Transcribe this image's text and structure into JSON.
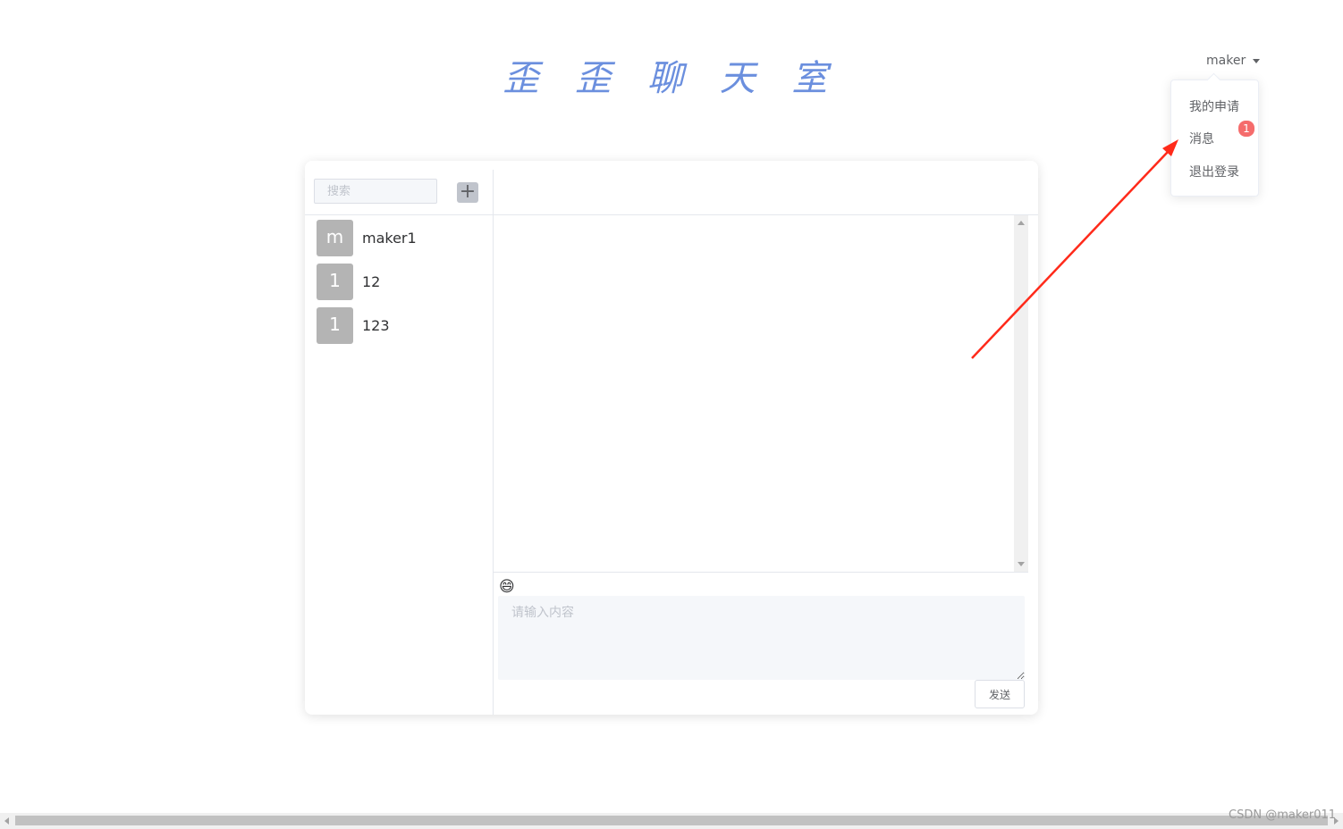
{
  "header": {
    "title": "歪 歪 聊 天 室"
  },
  "user_menu": {
    "username": "maker",
    "items": [
      {
        "label": "我的申请"
      },
      {
        "label": "消息",
        "badge": "1"
      },
      {
        "label": "退出登录"
      }
    ]
  },
  "sidebar": {
    "search_placeholder": "搜索",
    "add_label": "+",
    "contacts": [
      {
        "avatar": "m",
        "name": "maker1"
      },
      {
        "avatar": "1",
        "name": "12"
      },
      {
        "avatar": "1",
        "name": "123"
      }
    ]
  },
  "composer": {
    "emoji": "😄",
    "placeholder": "请输入内容",
    "send_label": "发送"
  },
  "watermark": "CSDN @maker011",
  "colors": {
    "title": "#6b8fde",
    "badge": "#f56c6c",
    "avatar": "#b4b4b4",
    "arrow": "#ff2a1a"
  }
}
